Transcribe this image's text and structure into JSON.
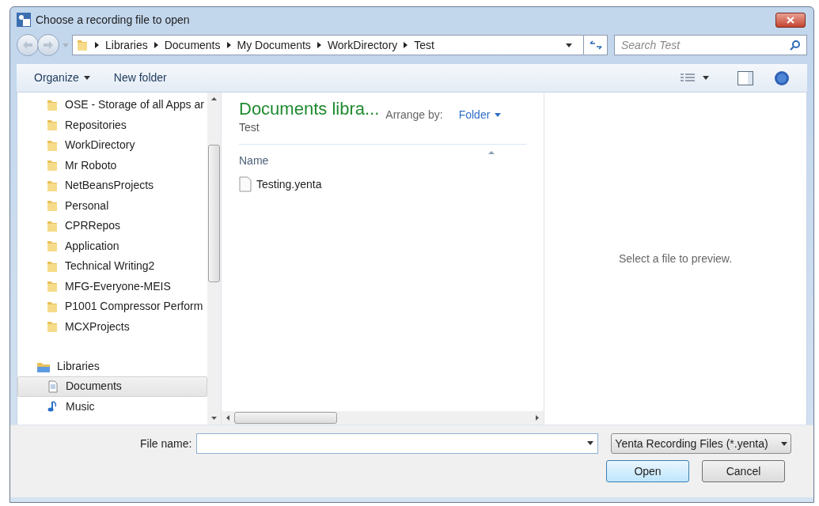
{
  "window": {
    "title": "Choose a recording file to open"
  },
  "address": {
    "crumbs": [
      "Libraries",
      "Documents",
      "My Documents",
      "WorkDirectory",
      "Test"
    ]
  },
  "search": {
    "placeholder": "Search Test"
  },
  "toolbar": {
    "organize": "Organize",
    "new_folder": "New folder"
  },
  "nav": {
    "folders": [
      {
        "label": "OSE - Storage of all Apps ar",
        "selected": false
      },
      {
        "label": "Repositories",
        "selected": false
      },
      {
        "label": "WorkDirectory",
        "selected": false
      },
      {
        "label": "Mr Roboto",
        "selected": false
      },
      {
        "label": "NetBeansProjects",
        "selected": false
      },
      {
        "label": "Personal",
        "selected": false
      },
      {
        "label": "CPRRepos",
        "selected": false
      },
      {
        "label": "Application",
        "selected": false
      },
      {
        "label": "Technical Writing2",
        "selected": false
      },
      {
        "label": "MFG-Everyone-MEIS",
        "selected": false
      },
      {
        "label": "P1001 Compressor Perform",
        "selected": false
      },
      {
        "label": "MCXProjects",
        "selected": false
      }
    ],
    "libraries": {
      "label": "Libraries",
      "children": [
        {
          "label": "Documents",
          "kind": "document",
          "selected": true
        },
        {
          "label": "Music",
          "kind": "music",
          "selected": false
        }
      ]
    }
  },
  "content": {
    "title": "Documents libra...",
    "subtitle": "Test",
    "arrange_label": "Arrange by:",
    "arrange_value": "Folder",
    "column": "Name",
    "files": [
      {
        "name": "Testing.yenta",
        "selected": false
      }
    ]
  },
  "preview": {
    "message": "Select a file to preview."
  },
  "footer": {
    "file_name_label": "File name:",
    "file_type": "Yenta Recording Files (*.yenta)",
    "open": "Open",
    "cancel": "Cancel"
  }
}
